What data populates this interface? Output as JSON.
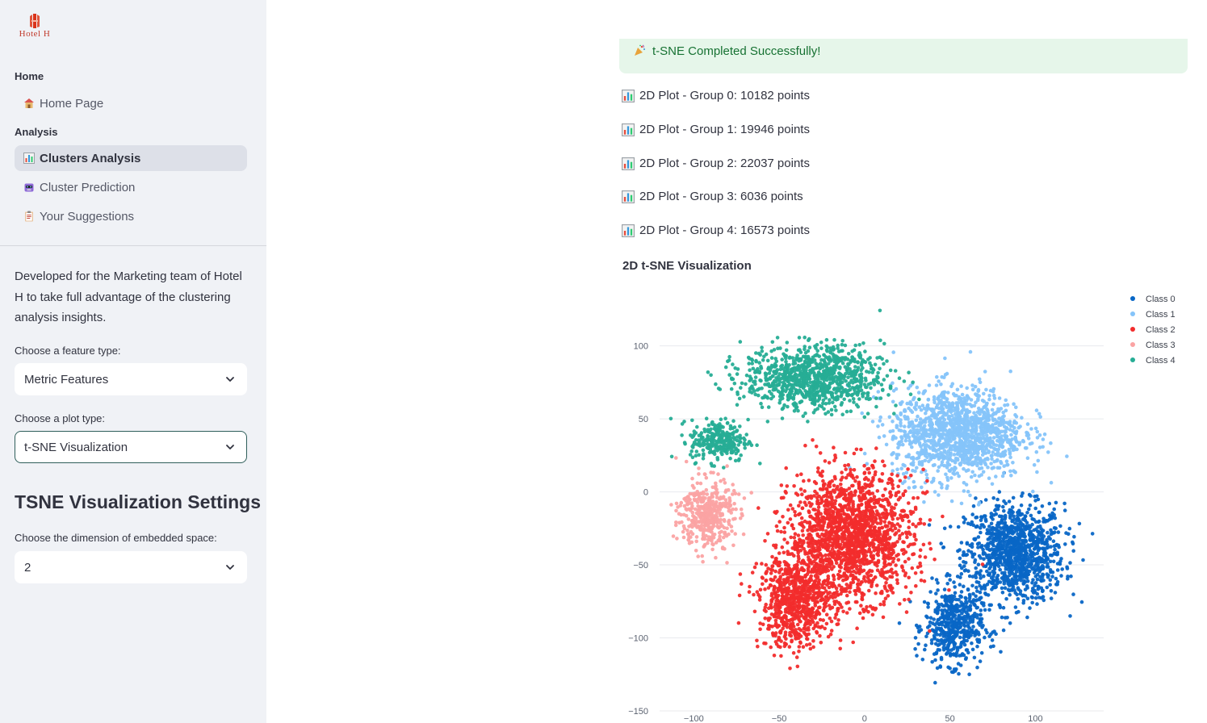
{
  "sidebar": {
    "logo_text": "Hotel H",
    "sections": [
      {
        "title": "Home",
        "items": [
          {
            "label": "Home Page",
            "icon": "house-icon"
          }
        ]
      },
      {
        "title": "Analysis",
        "items": [
          {
            "label": "Clusters Analysis",
            "icon": "bar-chart-icon",
            "active": true
          },
          {
            "label": "Cluster Prediction",
            "icon": "robot-icon"
          },
          {
            "label": "Your Suggestions",
            "icon": "clipboard-icon"
          }
        ]
      }
    ],
    "description": "Developed for the Marketing team of Hotel H to take full advantage of the clustering analysis insights.",
    "feature_label": "Choose a feature type:",
    "feature_value": "Metric Features",
    "plot_label": "Choose a plot type:",
    "plot_value": "t-SNE Visualization",
    "settings_title": "TSNE Visualization Settings",
    "dimension_label": "Choose the dimension of embedded space:",
    "dimension_value": "2"
  },
  "main": {
    "success_message": "t-SNE Completed Successfully!",
    "group_lines": [
      "2D Plot - Group 0: 10182 points",
      "2D Plot - Group 1: 19946 points",
      "2D Plot - Group 2: 22037 points",
      "2D Plot - Group 3: 6036 points",
      "2D Plot - Group 4: 16573 points"
    ],
    "viz_title": "2D t-SNE Visualization"
  },
  "chart_data": {
    "type": "scatter",
    "title": "2D t-SNE Visualization",
    "xlabel": "",
    "ylabel": "",
    "xlim": [
      -120,
      140
    ],
    "ylim": [
      -155,
      128
    ],
    "xticks": [
      -100,
      -50,
      0,
      50,
      100
    ],
    "yticks": [
      100,
      50,
      0,
      -50,
      -100,
      -150
    ],
    "grid": true,
    "legend": "top-right",
    "series": [
      {
        "name": "Class 0",
        "color": "#0866c6",
        "clusters": [
          {
            "cx": 88,
            "cy": -42,
            "sx": 24,
            "sy": 28
          },
          {
            "cx": 52,
            "cy": -92,
            "sx": 14,
            "sy": 22
          }
        ]
      },
      {
        "name": "Class 1",
        "color": "#85c4fa",
        "clusters": [
          {
            "cx": 55,
            "cy": 40,
            "sx": 32,
            "sy": 26
          }
        ]
      },
      {
        "name": "Class 2",
        "color": "#f22c2c",
        "clusters": [
          {
            "cx": -8,
            "cy": -30,
            "sx": 30,
            "sy": 36
          },
          {
            "cx": -40,
            "cy": -75,
            "sx": 18,
            "sy": 26
          }
        ]
      },
      {
        "name": "Class 3",
        "color": "#fba3a3",
        "clusters": [
          {
            "cx": -92,
            "cy": -15,
            "sx": 13,
            "sy": 20
          }
        ]
      },
      {
        "name": "Class 4",
        "color": "#26ad95",
        "clusters": [
          {
            "cx": -30,
            "cy": 78,
            "sx": 34,
            "sy": 18
          },
          {
            "cx": -85,
            "cy": 35,
            "sx": 14,
            "sy": 12
          }
        ]
      }
    ]
  }
}
